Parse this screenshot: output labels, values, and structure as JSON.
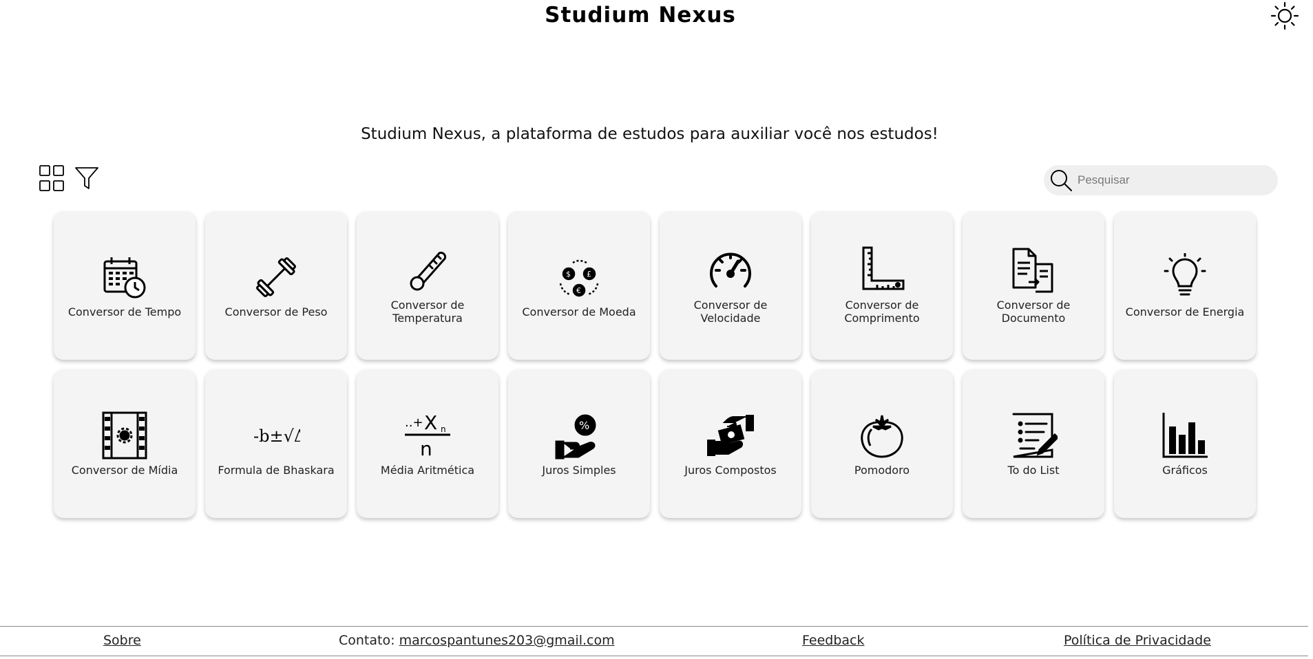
{
  "header": {
    "title": "Studium Nexus",
    "theme_icon": "sun-icon"
  },
  "tagline": "Studium Nexus, a plataforma de estudos para auxiliar você nos estudos!",
  "toolbar": {
    "grid_icon": "grid-view-icon",
    "filter_icon": "filter-icon"
  },
  "search": {
    "placeholder": "Pesquisar",
    "value": ""
  },
  "cards": [
    {
      "label": "Conversor de Tempo",
      "icon": "calendar-clock-icon"
    },
    {
      "label": "Conversor de Peso",
      "icon": "dumbbell-icon"
    },
    {
      "label": "Conversor de Temperatura",
      "icon": "thermometer-icon"
    },
    {
      "label": "Conversor de Moeda",
      "icon": "currency-exchange-icon"
    },
    {
      "label": "Conversor de Velocidade",
      "icon": "speedometer-icon"
    },
    {
      "label": "Conversor de Comprimento",
      "icon": "ruler-icon"
    },
    {
      "label": "Conversor de Documento",
      "icon": "document-convert-icon"
    },
    {
      "label": "Conversor de Energia",
      "icon": "lightbulb-icon"
    },
    {
      "label": "Conversor de Mídia",
      "icon": "film-icon"
    },
    {
      "label": "Formula de Bhaskara",
      "icon": "formula-icon"
    },
    {
      "label": "Média Aritmética",
      "icon": "average-icon"
    },
    {
      "label": "Juros Simples",
      "icon": "hand-percent-icon"
    },
    {
      "label": "Juros Compostos",
      "icon": "hand-money-icon"
    },
    {
      "label": "Pomodoro",
      "icon": "tomato-icon"
    },
    {
      "label": "To do List",
      "icon": "checklist-icon"
    },
    {
      "label": "Gráficos",
      "icon": "bar-chart-icon"
    }
  ],
  "footer": {
    "about": "Sobre",
    "contact_label": "Contato:",
    "contact_email": "marcospantunes203@gmail.com",
    "feedback": "Feedback",
    "privacy": "Política de Privacidade"
  }
}
